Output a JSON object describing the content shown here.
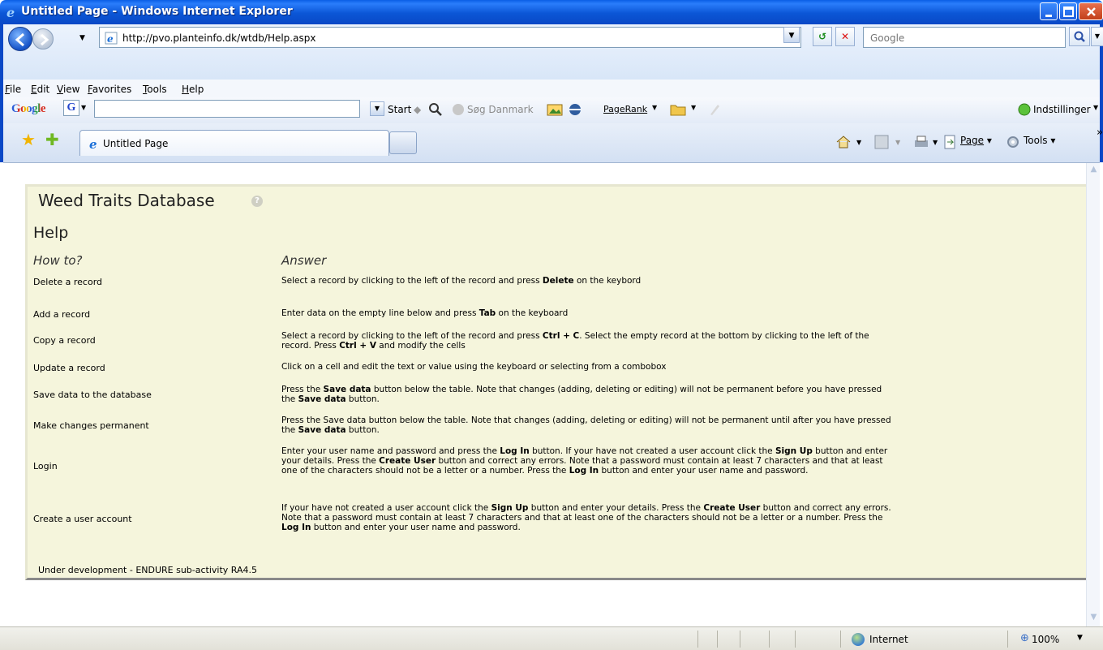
{
  "window": {
    "title": "Untitled Page - Windows Internet Explorer"
  },
  "address_bar": {
    "url": "http://pvo.planteinfo.dk/wtdb/Help.aspx",
    "search_placeholder": "Google"
  },
  "menu": [
    "File",
    "Edit",
    "View",
    "Favorites",
    "Tools",
    "Help"
  ],
  "google_toolbar": {
    "logo": "Google",
    "g_button": "G",
    "start_label": "Start",
    "sog_danmark_label": "Søg Danmark",
    "pagerank_label": "PageRank",
    "settings_label": "Indstillinger"
  },
  "tabs": {
    "active_label": "Untitled Page"
  },
  "command_bar": {
    "page_label": "Page",
    "tools_label": "Tools",
    "more": "»"
  },
  "page": {
    "site_title": "Weed Traits Database",
    "help_icon": "?",
    "heading": "Help",
    "col_howto": "How to?",
    "col_answer": "Answer",
    "rows": [
      {
        "q": "Delete a record",
        "a": [
          {
            "t": "Select a record by clicking to the left of the record and press "
          },
          {
            "t": "Delete",
            "b": true
          },
          {
            "t": " on the keybord"
          }
        ]
      },
      {
        "q": "Add a record",
        "a": [
          {
            "t": "Enter data on the empty line below and press "
          },
          {
            "t": "Tab",
            "b": true
          },
          {
            "t": " on the keyboard"
          }
        ]
      },
      {
        "q": "Copy a record",
        "a": [
          {
            "t": "Select a record by clicking to the left of the record and press "
          },
          {
            "t": "Ctrl + C",
            "b": true
          },
          {
            "t": ". Select the empty record at the bottom by clicking to the left of the record. Press "
          },
          {
            "t": "Ctrl + V",
            "b": true
          },
          {
            "t": " and modify the cells"
          }
        ]
      },
      {
        "q": "Update a record",
        "a": [
          {
            "t": "Click on a cell and edit the text or value using the keyboard or selecting from a combobox"
          }
        ]
      },
      {
        "q": "Save data to the database",
        "a": [
          {
            "t": "Press the "
          },
          {
            "t": "Save data",
            "b": true
          },
          {
            "t": " button below the table. Note that changes (adding, deleting or editing) will not be permanent before you have pressed the "
          },
          {
            "t": "Save data",
            "b": true
          },
          {
            "t": " button."
          }
        ]
      },
      {
        "q": "Make changes permanent",
        "a": [
          {
            "t": "Press the Save data button below the table. Note that changes (adding, deleting or editing) will not be permanent until after you have pressed the "
          },
          {
            "t": "Save data",
            "b": true
          },
          {
            "t": " button."
          }
        ]
      },
      {
        "q": "Login",
        "a": [
          {
            "t": "Enter your user name and password and press the "
          },
          {
            "t": "Log In",
            "b": true
          },
          {
            "t": " button. If your have not created a user account click the "
          },
          {
            "t": "Sign Up",
            "b": true
          },
          {
            "t": " button and enter your details. Press the "
          },
          {
            "t": "Create User",
            "b": true
          },
          {
            "t": " button and correct any errors. Note that a password must contain at least 7 characters and that at least one of the characters should not be a letter or a number. Press the "
          },
          {
            "t": "Log In",
            "b": true
          },
          {
            "t": " button and enter your user name and password."
          }
        ]
      },
      {
        "q": "Create a user account",
        "a": [
          {
            "t": "If your have not created a user account click the "
          },
          {
            "t": "Sign Up",
            "b": true
          },
          {
            "t": " button and enter your details. Press the "
          },
          {
            "t": "Create User",
            "b": true
          },
          {
            "t": " button and correct any errors. Note that a password must contain at least 7 characters and that at least one of the characters should not be a letter or a number. Press the "
          },
          {
            "t": "Log In",
            "b": true
          },
          {
            "t": " button and enter your user name and password."
          }
        ]
      }
    ],
    "footer": "Under development - ENDURE sub-activity RA4.5"
  },
  "status_bar": {
    "zone": "Internet",
    "zoom": "100%"
  },
  "colors": {
    "titlebar": "#0a5fe6",
    "panel_bg": "#f5f5dc",
    "panel_border": "#8a8a8a"
  }
}
